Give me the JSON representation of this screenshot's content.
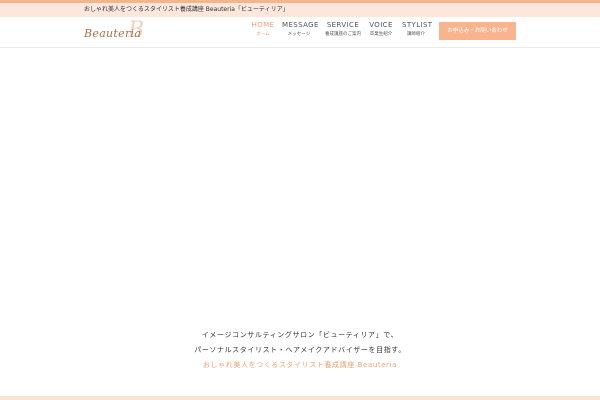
{
  "tagline": "おしゃれ美人をつくるスタイリスト養成講座 Beauteria「ビューティリア」",
  "logo": {
    "text": "Beauteria",
    "mark": "B"
  },
  "nav": [
    {
      "en": "HOME",
      "ja": "ホーム",
      "active": true
    },
    {
      "en": "MESSAGE",
      "ja": "メッセージ",
      "active": false
    },
    {
      "en": "SERVICE",
      "ja": "養成講座のご案内",
      "active": false
    },
    {
      "en": "VOICE",
      "ja": "卒業生紹介",
      "active": false
    },
    {
      "en": "STYLIST",
      "ja": "講師紹介",
      "active": false
    }
  ],
  "cta_label": "お申込み・お問い合わせ",
  "hero": {
    "line1": "イメージコンサルティングサロン「ビューティリア」で、",
    "line2": "パーソナルスタイリスト・ヘアメイクアドバイザーを目指す。",
    "line3": "おしゃれ美人をつくるスタイリスト養成講座 Beauteria"
  },
  "colors": {
    "accent": "#f0a070",
    "cta_bg": "#f7b48e",
    "tagline_bg": "#fbe7dc"
  }
}
